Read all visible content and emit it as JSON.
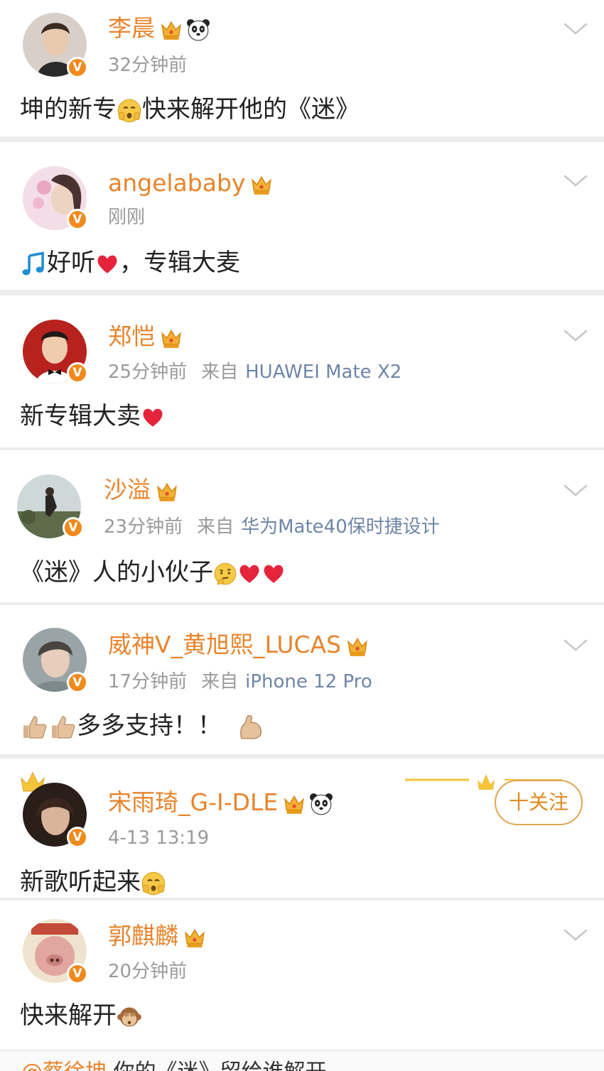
{
  "posts": [
    {
      "name": "李晨",
      "time": "32分钟前",
      "source": "",
      "device": "",
      "text": "坤的新专",
      "text2": "快来解开他的《迷》",
      "panda": true
    },
    {
      "name": "angelababy",
      "time": "刚刚",
      "source": "",
      "device": "",
      "text": "好听",
      "text2": "，专辑大麦",
      "panda": false
    },
    {
      "name": "郑恺",
      "time": "25分钟前",
      "source": "来自",
      "device": "HUAWEI Mate X2",
      "text": "新专辑大卖",
      "text2": "",
      "panda": false
    },
    {
      "name": "沙溢",
      "time": "23分钟前",
      "source": "来自",
      "device": "华为Mate40保时捷设计",
      "text": "《迷》人的小伙子",
      "text2": "",
      "panda": false
    },
    {
      "name": "威神V_黄旭熙_LUCAS",
      "time": "17分钟前",
      "source": "来自",
      "device": "iPhone 12 Pro",
      "text": "多多支持！！",
      "text2": "",
      "panda": false
    },
    {
      "name": "宋雨琦_G-I-DLE",
      "time": "4-13 13:19",
      "source": "",
      "device": "",
      "text": "新歌听起来",
      "text2": "",
      "panda": true,
      "follow": "十关注"
    },
    {
      "name": "郭麒麟",
      "time": "20分钟前",
      "source": "",
      "device": "",
      "text": "快来解开",
      "text2": "",
      "panda": false
    }
  ],
  "vip_badge": "V",
  "bottom": {
    "name": "@蔡徐坤",
    "text": " 你的《迷》留给谁解开"
  },
  "colors": {
    "name": "#e8842c",
    "meta": "#9a9a9a",
    "device": "#6f85a6",
    "badge": "#f08a1c"
  },
  "icons": [
    "crown-icon",
    "panda-icon",
    "chevron-down-icon",
    "heart-icon",
    "music-note-icon",
    "thumbs-up-icon",
    "flexed-arm-icon",
    "shy-face-icon",
    "thinking-face-icon",
    "monkey-face-icon"
  ]
}
